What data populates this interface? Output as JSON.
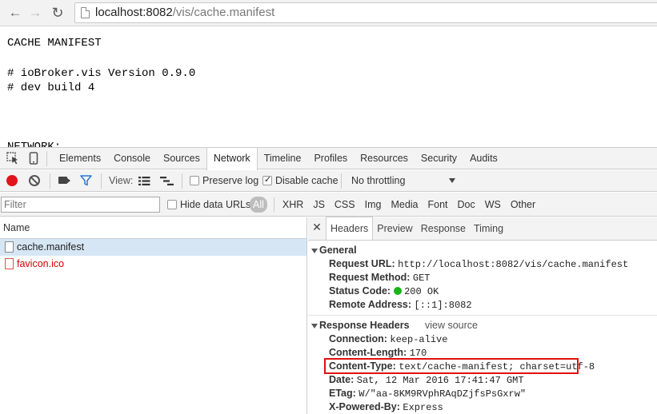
{
  "browser": {
    "url_host": "localhost:8082",
    "url_path": "/vis/cache.manifest"
  },
  "page": {
    "lines": [
      "CACHE MANIFEST",
      "# ioBroker.vis Version 0.9.0",
      "# dev build 4",
      "NETWORK:"
    ]
  },
  "devtools": {
    "tabs": [
      "Elements",
      "Console",
      "Sources",
      "Network",
      "Timeline",
      "Profiles",
      "Resources",
      "Security",
      "Audits"
    ],
    "active_tab": "Network",
    "toolbar": {
      "view_label": "View:",
      "preserve_log_label": "Preserve log",
      "preserve_log_checked": false,
      "disable_cache_label": "Disable cache",
      "disable_cache_checked": true,
      "throttling_value": "No throttling"
    },
    "filterbar": {
      "filter_placeholder": "Filter",
      "hide_data_urls_label": "Hide data URLs",
      "type_filters": [
        "All",
        "XHR",
        "JS",
        "CSS",
        "Img",
        "Media",
        "Font",
        "Doc",
        "WS",
        "Other"
      ],
      "active_type": "All"
    },
    "request_list": {
      "header": "Name",
      "requests": [
        {
          "name": "cache.manifest",
          "selected": true,
          "error": false
        },
        {
          "name": "favicon.ico",
          "selected": false,
          "error": true
        }
      ]
    },
    "details": {
      "close_glyph": "✕",
      "tabs": [
        "Headers",
        "Preview",
        "Response",
        "Timing"
      ],
      "active_tab": "Headers",
      "general": {
        "title": "General",
        "request_url_key": "Request URL:",
        "request_url": "http://localhost:8082/vis/cache.manifest",
        "request_method_key": "Request Method:",
        "request_method": "GET",
        "status_code_key": "Status Code:",
        "status_code": "200 OK",
        "remote_address_key": "Remote Address:",
        "remote_address": "[::1]:8082"
      },
      "response_headers": {
        "title": "Response Headers",
        "view_source": "view source",
        "items": [
          {
            "key": "Connection:",
            "value": "keep-alive"
          },
          {
            "key": "Content-Length:",
            "value": "170"
          },
          {
            "key": "Content-Type:",
            "value": "text/cache-manifest; charset=utf-8"
          },
          {
            "key": "Date:",
            "value": "Sat, 12 Mar 2016 17:41:47 GMT"
          },
          {
            "key": "ETag:",
            "value": "W/\"aa-8KM9RVphRAqDZjfsPsGxrw\""
          },
          {
            "key": "X-Powered-By:",
            "value": "Express"
          }
        ]
      }
    }
  },
  "colors": {
    "record": "#e2141b",
    "status_ok": "#18b418",
    "highlight_box": "#e01010",
    "error_text": "#d50000",
    "selected_row": "#d6e6f5"
  }
}
